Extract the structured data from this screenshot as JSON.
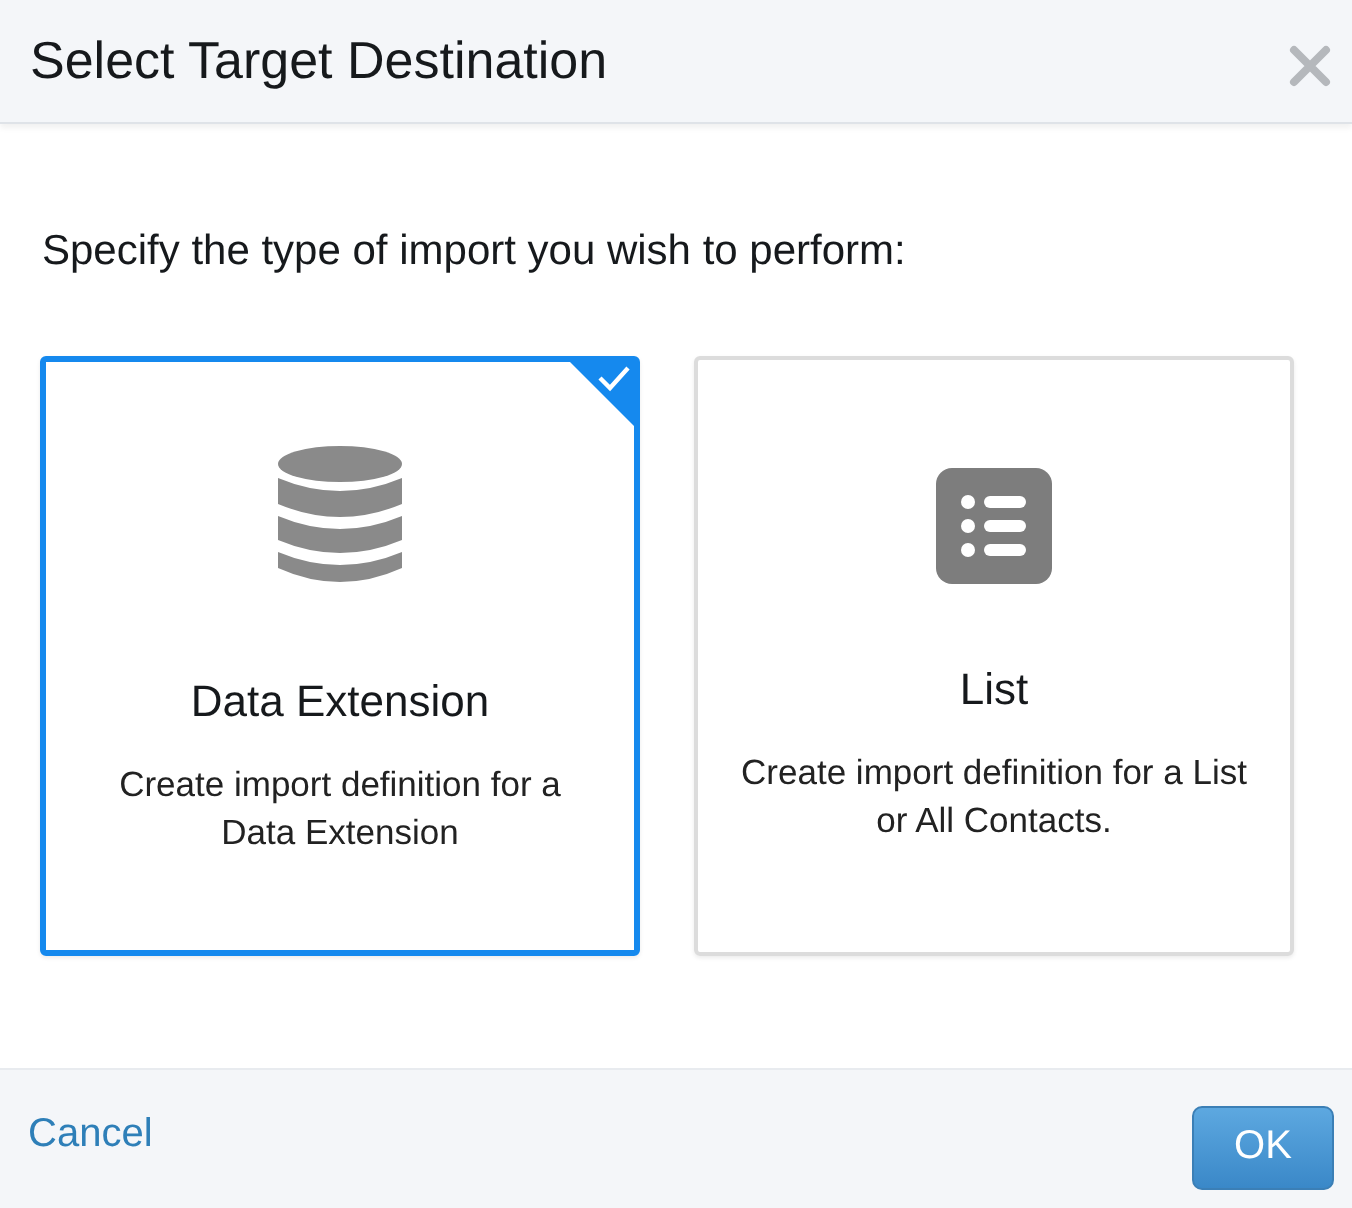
{
  "dialog": {
    "title": "Select Target Destination"
  },
  "prompt": "Specify the type of import you wish to perform:",
  "options": [
    {
      "kind": "database",
      "title": "Data Extension",
      "description": "Create import definition for a Data Extension",
      "selected": true
    },
    {
      "kind": "list",
      "title": "List",
      "description": "Create import definition for a List or All Contacts.",
      "selected": false
    }
  ],
  "footer": {
    "cancel": "Cancel",
    "ok": "OK"
  }
}
